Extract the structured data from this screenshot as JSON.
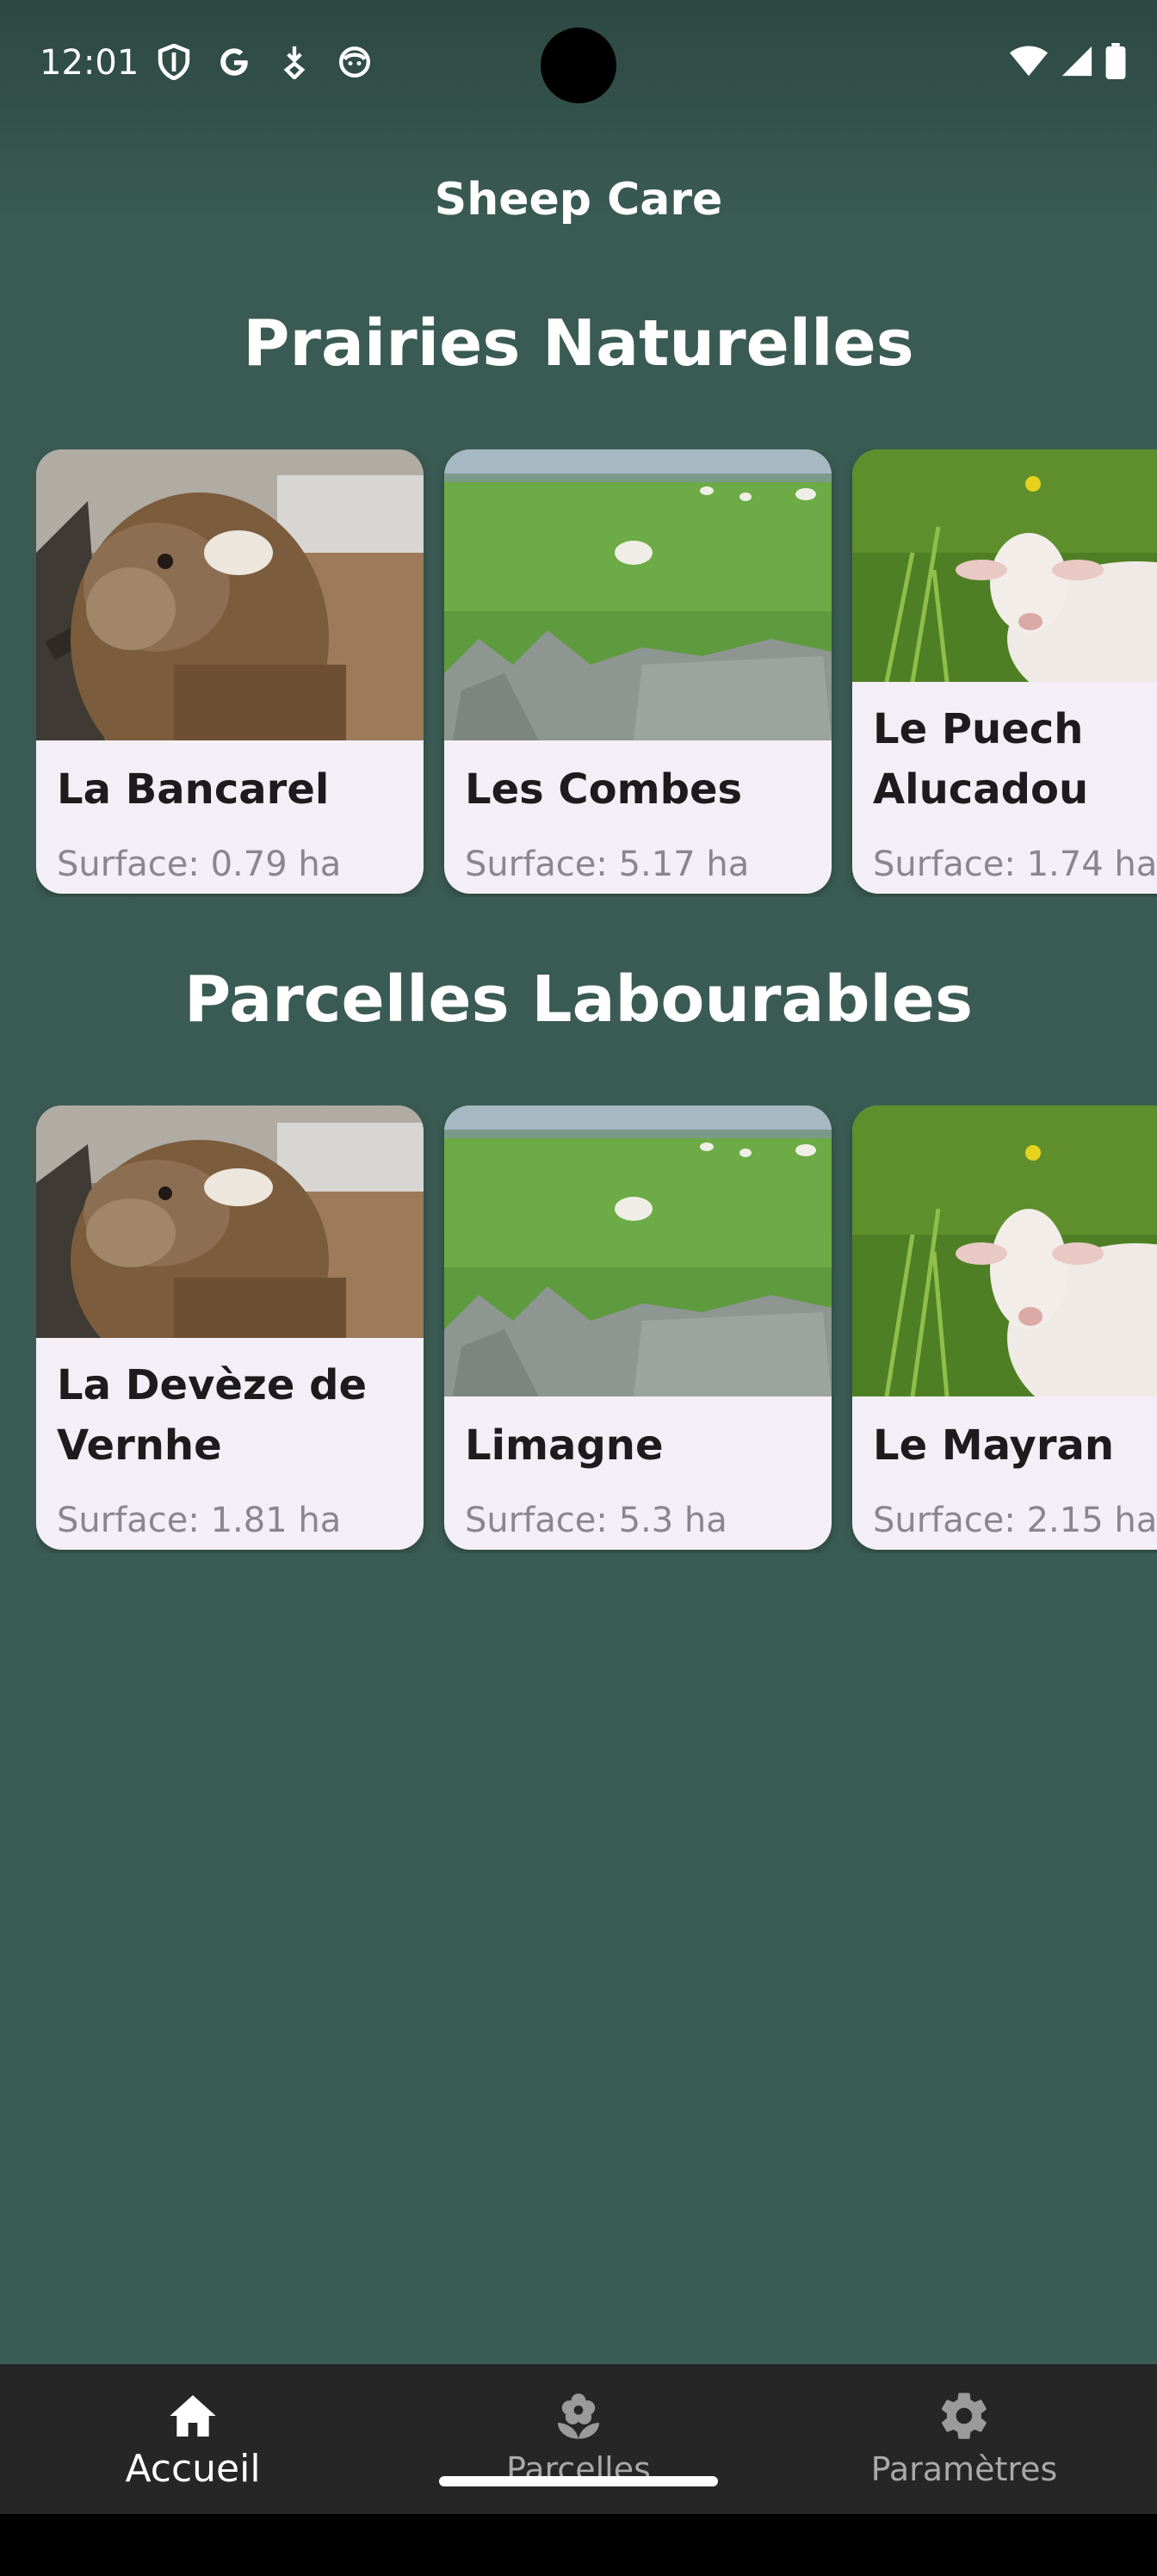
{
  "status_bar": {
    "time": "12:01",
    "left_icons": [
      "shield-icon",
      "google-icon",
      "download-icon",
      "face-icon"
    ],
    "right_icons": [
      "wifi-icon",
      "signal-icon",
      "battery-icon"
    ]
  },
  "app": {
    "title": "Sheep Care"
  },
  "sections": [
    {
      "title": "Prairies Naturelles",
      "cards": [
        {
          "name": "La Bancarel",
          "surface": "Surface: 0.79 ha",
          "image": "brown-sheep"
        },
        {
          "name": "Les Combes",
          "surface": "Surface: 5.17 ha",
          "image": "pasture-wall"
        },
        {
          "name": "Le Puech Alucadou",
          "surface": "Surface: 1.74 ha",
          "image": "white-sheep-grass"
        }
      ]
    },
    {
      "title": "Parcelles Labourables",
      "cards": [
        {
          "name": "La Devèze de Vernhe",
          "surface": "Surface: 1.81 ha",
          "image": "brown-sheep"
        },
        {
          "name": "Limagne",
          "surface": "Surface: 5.3 ha",
          "image": "pasture-wall"
        },
        {
          "name": "Le Mayran",
          "surface": "Surface: 2.15 ha",
          "image": "white-sheep-grass"
        }
      ]
    }
  ],
  "bottom_nav": {
    "items": [
      {
        "label": "Accueil",
        "icon": "home-icon",
        "active": true
      },
      {
        "label": "Parcelles",
        "icon": "flower-icon",
        "active": false
      },
      {
        "label": "Paramètres",
        "icon": "gear-icon",
        "active": false
      }
    ]
  },
  "colors": {
    "background": "#3a5b53",
    "card": "#f4eff6",
    "nav": "#262626"
  }
}
